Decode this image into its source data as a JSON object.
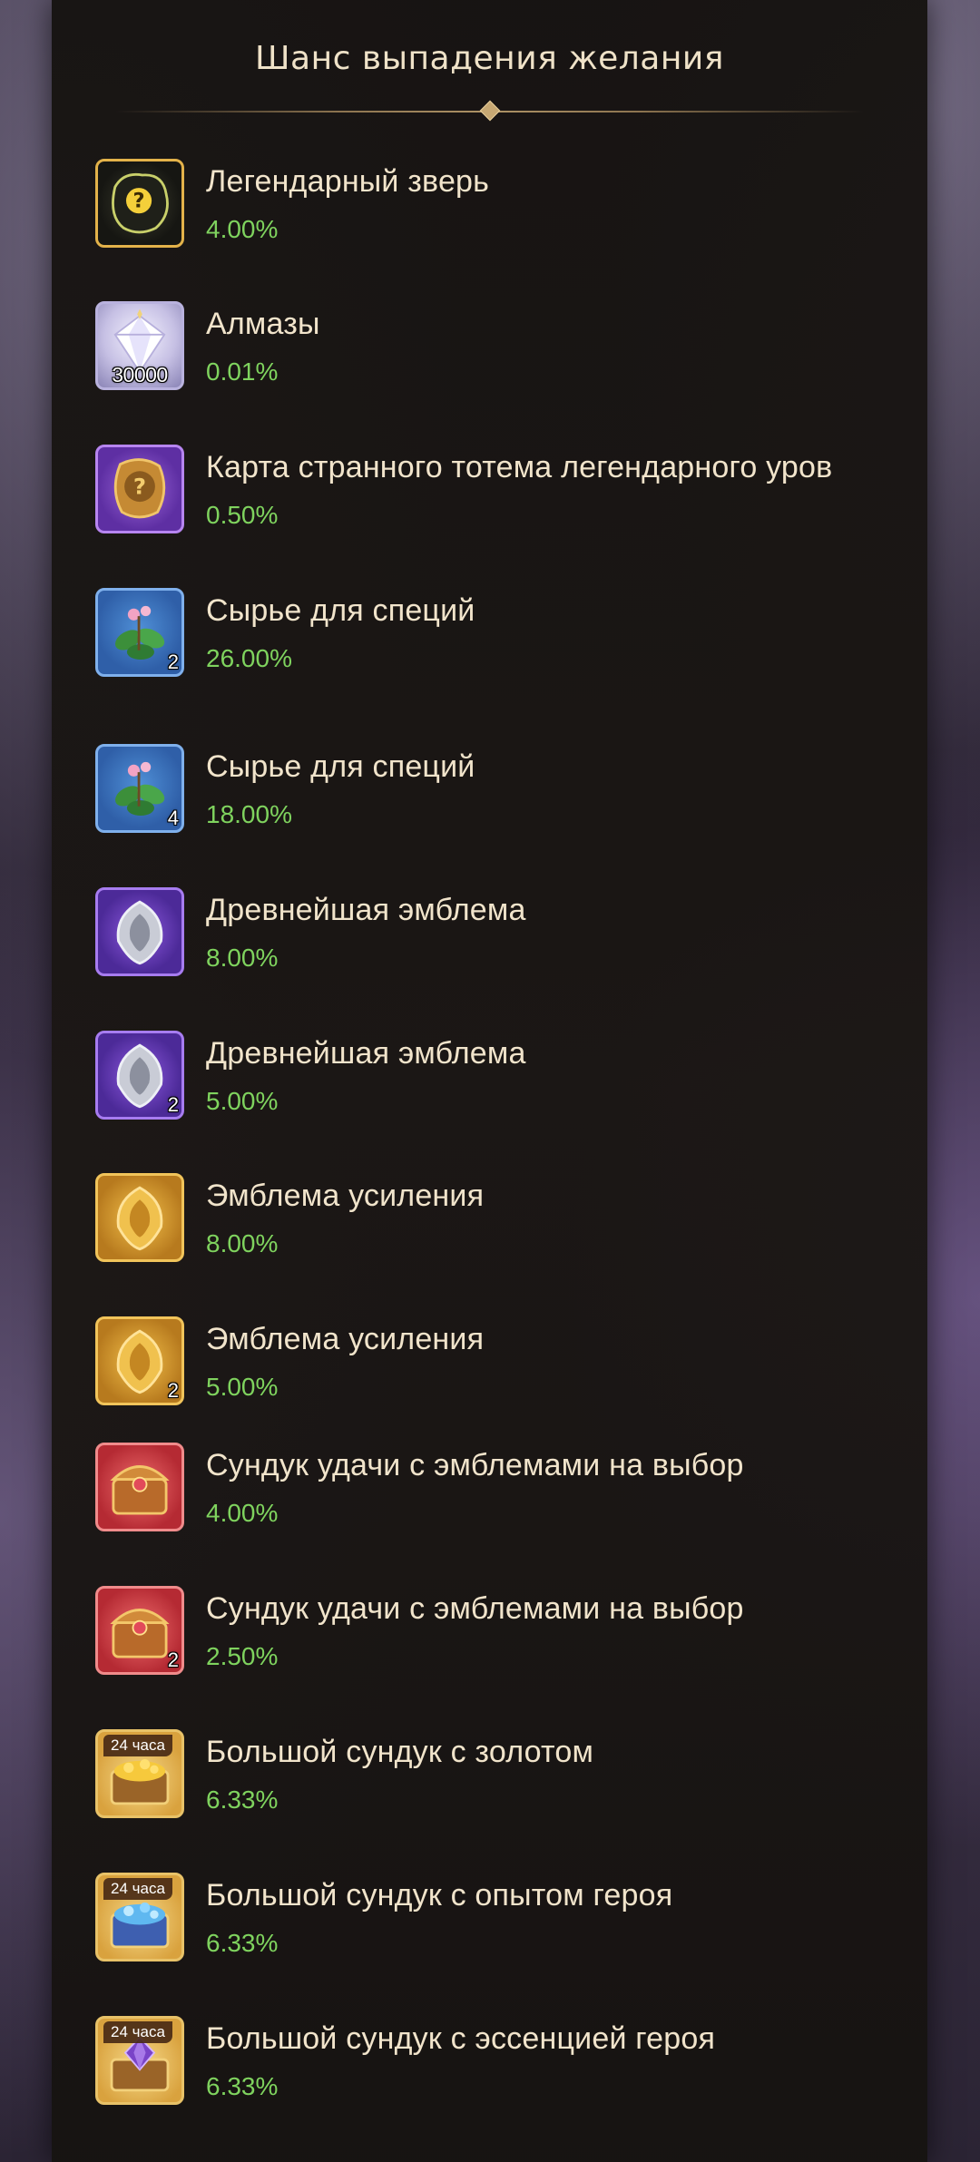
{
  "title": "Шанс выпадения желания",
  "items": [
    {
      "icon": "mystery-beast-icon",
      "name": "Легендарный зверь",
      "chance": "4.00%",
      "count": ""
    },
    {
      "icon": "diamond-icon",
      "name": "Алмазы",
      "chance": "0.01%",
      "count": "30000"
    },
    {
      "icon": "totem-card-icon",
      "name": "Карта странного тотема легендарного уров",
      "chance": "0.50%",
      "count": ""
    },
    {
      "icon": "herb-icon",
      "name": "Сырье для специй",
      "chance": "26.00%",
      "count": "2"
    },
    {
      "icon": "herb-icon",
      "name": "Сырье для специй",
      "chance": "18.00%",
      "count": "4"
    },
    {
      "icon": "ancient-emblem-icon",
      "name": "Древнейшая эмблема",
      "chance": "8.00%",
      "count": ""
    },
    {
      "icon": "ancient-emblem-icon",
      "name": "Древнейшая эмблема",
      "chance": "5.00%",
      "count": "2"
    },
    {
      "icon": "boost-emblem-icon",
      "name": "Эмблема усиления",
      "chance": "8.00%",
      "count": ""
    },
    {
      "icon": "boost-emblem-icon",
      "name": "Эмблема усиления",
      "chance": "5.00%",
      "count": "2"
    },
    {
      "icon": "luck-chest-icon",
      "name": "Сундук удачи с эмблемами на выбор",
      "chance": "4.00%",
      "count": ""
    },
    {
      "icon": "luck-chest-icon",
      "name": "Сундук удачи с эмблемами на выбор",
      "chance": "2.50%",
      "count": "2"
    },
    {
      "icon": "gold-chest-icon",
      "name": "Большой сундук с золотом",
      "chance": "6.33%",
      "count": "",
      "badge": "24 часа"
    },
    {
      "icon": "hero-exp-chest-icon",
      "name": "Большой сундук с опытом героя",
      "chance": "6.33%",
      "count": "",
      "badge": "24 часа"
    },
    {
      "icon": "hero-essence-chest-icon",
      "name": "Большой сундук с эссенцией героя",
      "chance": "6.33%",
      "count": "",
      "badge": "24 часа"
    }
  ]
}
